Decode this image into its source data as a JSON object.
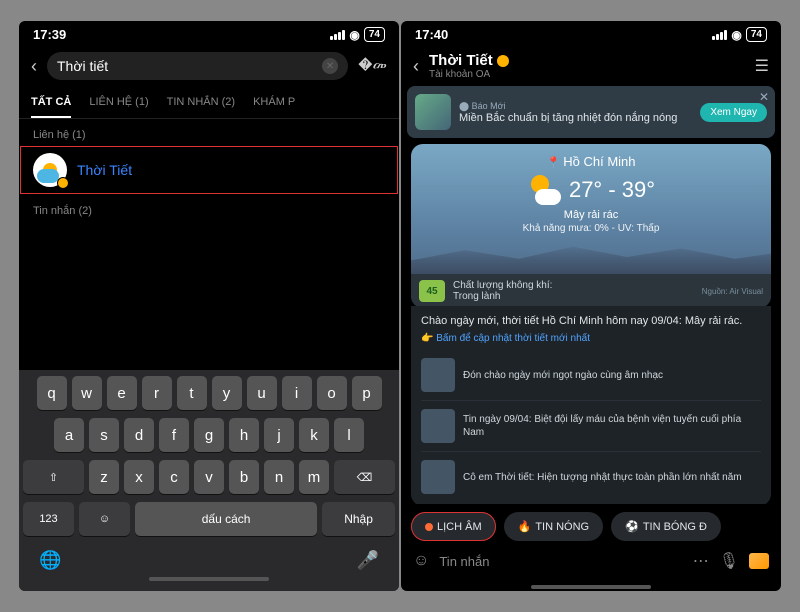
{
  "left": {
    "time": "17:39",
    "battery": "74",
    "search_value": "Thời tiết",
    "tabs": [
      "TẤT CẢ",
      "LIÊN HỆ (1)",
      "TIN NHẮN (2)",
      "KHÁM P"
    ],
    "section_contacts": "Liên hệ (1)",
    "contact_name": "Thời Tiết",
    "section_messages": "Tin nhắn (2)",
    "keys_r1": [
      "q",
      "w",
      "e",
      "r",
      "t",
      "y",
      "u",
      "i",
      "o",
      "p"
    ],
    "keys_r2": [
      "a",
      "s",
      "d",
      "f",
      "g",
      "h",
      "j",
      "k",
      "l"
    ],
    "keys_r3_mid": [
      "z",
      "x",
      "c",
      "v",
      "b",
      "n",
      "m"
    ],
    "key_shift": "⇧",
    "key_del": "⌫",
    "key_123": "123",
    "key_space": "dấu cách",
    "key_enter": "Nhập"
  },
  "right": {
    "time": "17:40",
    "battery": "74",
    "title": "Thời Tiết",
    "subtitle": "Tài khoản OA",
    "banner_source": "Báo Mới",
    "banner_text": "Miền Bắc chuẩn bị tăng nhiệt đón nắng nóng",
    "banner_cta": "Xem Ngay",
    "weather": {
      "location": "Hồ Chí Minh",
      "temp": "27° - 39°",
      "desc": "Mây rải rác",
      "sub": "Khả năng mưa: 0% - UV: Thấp",
      "aq_value": "45",
      "aq_label": "Chất lượng không khí:",
      "aq_status": "Trong lành",
      "aq_source": "Nguồn: Air Visual"
    },
    "greeting": "Chào ngày mới, thời tiết Hồ Chí Minh hôm nay 09/04: Mây rải rác.",
    "update_link": "Bấm để cập nhật thời tiết mới nhất",
    "news": [
      "Đón chào ngày mới ngọt ngào cùng âm nhạc",
      "Tin ngày 09/04: Biệt đội lấy máu của bệnh viện tuyến cuối phía Nam",
      "Cô em Thời tiết: Hiện tượng nhật thực toàn phần lớn nhất năm"
    ],
    "chips": [
      "LỊCH ÂM",
      "TIN NÓNG",
      "TIN BÓNG Đ"
    ],
    "compose_placeholder": "Tin nhắn"
  }
}
